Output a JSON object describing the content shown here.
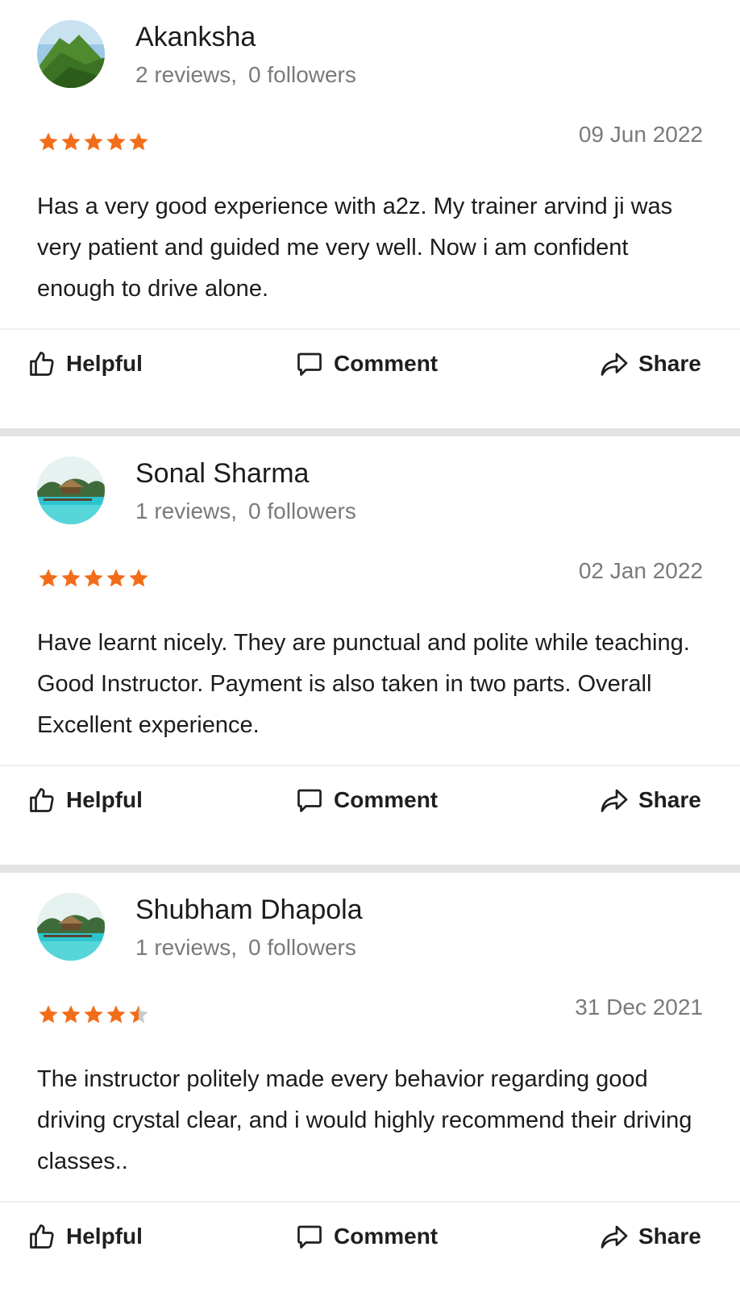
{
  "reviews": [
    {
      "name": "Akanksha",
      "reviews_count": "2 reviews,",
      "followers": "0 followers",
      "rating": 5,
      "date": "09 Jun 2022",
      "text": "Has a very good experience with a2z. My trainer arvind ji was very patient and guided me very well. Now i am confident enough to drive alone.",
      "avatar": "mountain-photo"
    },
    {
      "name": "Sonal Sharma",
      "reviews_count": "1 reviews,",
      "followers": "0 followers",
      "rating": 5,
      "date": "02 Jan 2022",
      "text": "Have learnt nicely. They are punctual and polite while teaching. Good Instructor. Payment is also taken in two parts. Overall Excellent experience.",
      "avatar": "beach-resort-photo"
    },
    {
      "name": "Shubham Dhapola",
      "reviews_count": "1 reviews,",
      "followers": "0 followers",
      "rating": 4.5,
      "date": "31 Dec 2021",
      "text": "The instructor politely made every behavior regarding good driving crystal clear, and i would highly recommend their driving classes..",
      "avatar": "beach-resort-photo"
    }
  ],
  "actions": {
    "helpful_label": "Helpful",
    "comment_label": "Comment",
    "share_label": "Share",
    "helpful_icon": "thumbs-up-icon",
    "comment_icon": "comment-bubble-icon",
    "share_icon": "share-arrow-icon"
  },
  "colors": {
    "star_filled": "#f26d1a",
    "star_empty": "#c9c9c9",
    "muted_text": "#7a7a7a",
    "separator": "#e3e3e3"
  }
}
